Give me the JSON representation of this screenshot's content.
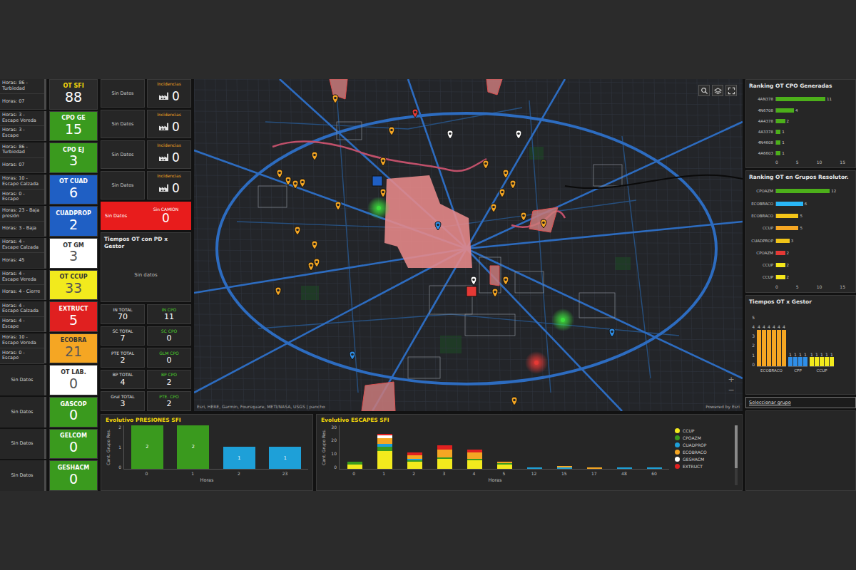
{
  "leftStatus": [
    {
      "lines": [
        "Horas: 86 - Turbiedad",
        "Horas: 07"
      ]
    },
    {
      "lines": [
        "Horas: 3 - Escape Vereda",
        "Horas: 3 - Escape"
      ]
    },
    {
      "lines": [
        "Horas: 86 - Turbiedad",
        "Horas: 07"
      ]
    },
    {
      "lines": [
        "Horas: 10 - Escape Calzada",
        "Horas: 0 - Escape"
      ]
    },
    {
      "lines": [
        "Horas: 23 - Baja presión",
        "Horas: 3 - Baja"
      ]
    },
    {
      "lines": [
        "Horas: 4 - Escape Calzada",
        "Horas: 45"
      ]
    },
    {
      "lines": [
        "Horas: 4 - Escape Vereda",
        "Horas: 4 - Cierre"
      ]
    },
    {
      "lines": [
        "Horas: 4 - Escape Calzada",
        "Horas: 4 - Escape"
      ]
    },
    {
      "lines": [
        "Horas: 10 - Escape Vereda",
        "Horas: 0 - Escape"
      ]
    },
    {
      "lines": [
        "Sin Datos"
      ]
    },
    {
      "lines": [
        "Sin Datos"
      ]
    },
    {
      "lines": [
        "Sin Datos"
      ]
    },
    {
      "lines": [
        "Sin Datos"
      ]
    }
  ],
  "indicators": [
    {
      "title": "OT SFI",
      "value": "88",
      "color": "#2b2b2b"
    },
    {
      "title": "CPO GE",
      "value": "15",
      "color": "#3a9a1e"
    },
    {
      "title": "CPO EJ",
      "value": "3",
      "color": "#3a9a1e"
    },
    {
      "title": "OT CUAD",
      "value": "6",
      "color": "#1f5fc4"
    },
    {
      "title": "CUADPROP",
      "value": "2",
      "color": "#1f5fc4"
    },
    {
      "title": "OT GM",
      "value": "3",
      "color": "#ffffff"
    },
    {
      "title": "OT CCUP",
      "value": "33",
      "color": "#f2ea1d"
    },
    {
      "title": "EXTRUCT",
      "value": "5",
      "color": "#e02020"
    },
    {
      "title": "ECOBRA",
      "value": "21",
      "color": "#f5a623"
    },
    {
      "title": "OT LAB.",
      "value": "0",
      "color": "#ffffff"
    },
    {
      "title": "GASCOP",
      "value": "0",
      "color": "#3a9a1e"
    },
    {
      "title": "GELCOM",
      "value": "0",
      "color": "#3a9a1e"
    },
    {
      "title": "GESHACM",
      "value": "0",
      "color": "#3a9a1e"
    }
  ],
  "incidents": [
    {
      "status": "Sin Datos",
      "label": "Incidencias",
      "value": "0"
    },
    {
      "status": "Sin Datos",
      "label": "Incidencias",
      "value": "0"
    },
    {
      "status": "Sin Datos",
      "label": "Incidencias",
      "value": "0"
    },
    {
      "status": "Sin Datos",
      "label": "Incidencias",
      "value": "0"
    }
  ],
  "alert": {
    "status": "Sin Datos",
    "label": "Sin CAMION",
    "value": "0"
  },
  "timesPanel": {
    "title": "Tiempos OT con PD x Gestor",
    "empty": "Sin datos"
  },
  "stats": [
    {
      "label": "IN TOTAL",
      "value": "70",
      "kind": "total"
    },
    {
      "label": "IN CPO",
      "value": "11",
      "kind": "cpo"
    },
    {
      "label": "SC TOTAL",
      "value": "7",
      "kind": "total"
    },
    {
      "label": "SC CPO",
      "value": "0",
      "kind": "cpo"
    },
    {
      "label": "PTE TOTAL",
      "value": "2",
      "kind": "total"
    },
    {
      "label": "GLM CPO",
      "value": "0",
      "kind": "cpo"
    },
    {
      "label": "BP TOTAL",
      "value": "4",
      "kind": "total"
    },
    {
      "label": "BP CPO",
      "value": "2",
      "kind": "cpo"
    },
    {
      "label": "Gral TOTAL",
      "value": "3",
      "kind": "total"
    },
    {
      "label": "PTE. CPO",
      "value": "2",
      "kind": "cpo"
    }
  ],
  "map": {
    "attribution": "Esri, HERE, Garmin, Foursquare, METI/NASA, USGS | pancho",
    "powered": "Powered by Esri",
    "zoomIn": "+",
    "zoomOut": "−",
    "markers": [
      {
        "kind": "pin",
        "color": "#f5a623"
      },
      {
        "kind": "pin",
        "color": "#e53935"
      },
      {
        "kind": "pin",
        "color": "#f5a623"
      },
      {
        "kind": "pin",
        "color": "#ffffff"
      },
      {
        "kind": "pin",
        "color": "#ffffff"
      },
      {
        "kind": "pin",
        "color": "#f5a623"
      },
      {
        "kind": "pin",
        "color": "#f5a623"
      },
      {
        "kind": "pin",
        "color": "#f5a623"
      },
      {
        "kind": "pin",
        "color": "#f5a623"
      },
      {
        "kind": "pin",
        "color": "#f5a623"
      },
      {
        "kind": "pin",
        "color": "#f5a623"
      },
      {
        "kind": "pin",
        "color": "#f5a623"
      },
      {
        "kind": "pin",
        "color": "#f5a623"
      },
      {
        "kind": "pin",
        "color": "#f5a623"
      },
      {
        "kind": "pin",
        "color": "#f5a623"
      },
      {
        "kind": "pin",
        "color": "#f5a623"
      },
      {
        "kind": "pin",
        "color": "#f5a623"
      },
      {
        "kind": "pin",
        "color": "#f5a623"
      },
      {
        "kind": "pin",
        "color": "#f5a623"
      },
      {
        "kind": "pin",
        "color": "#f5a623"
      },
      {
        "kind": "pin",
        "color": "#f5a623"
      },
      {
        "kind": "pin",
        "color": "#f5a623"
      },
      {
        "kind": "pin",
        "color": "#f5a623"
      },
      {
        "kind": "pin",
        "color": "#f5a623"
      },
      {
        "kind": "pin",
        "color": "#2f8fe8"
      },
      {
        "kind": "pin",
        "color": "#ffffff"
      },
      {
        "kind": "pin",
        "color": "#f5a623"
      },
      {
        "kind": "pin",
        "color": "#f5a623"
      },
      {
        "kind": "square",
        "color": "#e53935"
      },
      {
        "kind": "pin",
        "color": "#f5a623"
      },
      {
        "kind": "pin",
        "color": "#2f8fe8"
      },
      {
        "kind": "pin",
        "color": "#2f8fe8"
      },
      {
        "kind": "pin",
        "color": "#f5a623"
      },
      {
        "kind": "square",
        "color": "#1f5fc4"
      },
      {
        "kind": "glow",
        "color": "#3ddc3d"
      },
      {
        "kind": "glow",
        "color": "#3ddc3d"
      },
      {
        "kind": "glow",
        "color": "#e53935"
      }
    ]
  },
  "presiones": {
    "title": "Evolutivo PRESIONES SFI",
    "yTitle": "Cant. Grupo Res.",
    "xTitle": "Horas",
    "ticks": [
      "0",
      "1",
      "2"
    ],
    "bars": [
      {
        "label": "0",
        "value": 2,
        "text": "2",
        "color": "#3a9a1e"
      },
      {
        "label": "1",
        "value": 2,
        "text": "2",
        "color": "#3a9a1e"
      },
      {
        "label": "2",
        "value": 1,
        "text": "1",
        "color": "#1ea0d8"
      },
      {
        "label": "23",
        "value": 1,
        "text": "1",
        "color": "#1ea0d8"
      }
    ]
  },
  "escapes": {
    "title": "Evolutivo ESCAPES SFI",
    "yTitle": "Cant. Grupo Res.",
    "xTitle": "Horas",
    "ticks": [
      "0",
      "10",
      "20",
      "30"
    ],
    "hours": [
      "0",
      "1",
      "2",
      "3",
      "4",
      "5",
      "12",
      "15",
      "17",
      "48",
      "60"
    ],
    "series": [
      {
        "name": "CCUP",
        "color": "#f2ea1d",
        "values": [
          3,
          12,
          5,
          7,
          6,
          3,
          0,
          0,
          0,
          0,
          0
        ]
      },
      {
        "name": "CPOAZM",
        "color": "#3a9a1e",
        "values": [
          2,
          3,
          1,
          1,
          1,
          1,
          0,
          0,
          0,
          0,
          0
        ]
      },
      {
        "name": "CUADPROP",
        "color": "#1ea0d8",
        "values": [
          0,
          2,
          1,
          0,
          0,
          0,
          1,
          1,
          0,
          1,
          1
        ]
      },
      {
        "name": "ECOBRACO",
        "color": "#f5a623",
        "values": [
          0,
          4,
          2,
          5,
          4,
          1,
          0,
          1,
          1,
          0,
          0
        ]
      },
      {
        "name": "GESHACM",
        "color": "#ffffff",
        "values": [
          0,
          2,
          0,
          0,
          0,
          0,
          0,
          0,
          0,
          0,
          0
        ]
      },
      {
        "name": "EXTRUCT",
        "color": "#e02020",
        "values": [
          0,
          1,
          2,
          3,
          2,
          0,
          0,
          0,
          0,
          0,
          0
        ]
      }
    ]
  },
  "rankingCpo": {
    "title": "Ranking OT CPO Generadas",
    "ticks": [
      "0",
      "5",
      "10",
      "15"
    ],
    "bars": [
      {
        "label": "4AN378",
        "value": 11,
        "text": "11",
        "color": "#4caf1a"
      },
      {
        "label": "4N6708",
        "value": 4,
        "text": "4",
        "color": "#4caf1a"
      },
      {
        "label": "4A4378",
        "value": 2,
        "text": "2",
        "color": "#4caf1a"
      },
      {
        "label": "4A3378",
        "value": 1,
        "text": "1",
        "color": "#4caf1a"
      },
      {
        "label": "4N4608",
        "value": 1,
        "text": "1",
        "color": "#4caf1a"
      },
      {
        "label": "4A6603",
        "value": 1,
        "text": "1",
        "color": "#4caf1a"
      }
    ]
  },
  "rankingGrupos": {
    "title": "Ranking OT en Grupos Resolutor.",
    "ticks": [
      "0",
      "5",
      "10",
      "15"
    ],
    "bars": [
      {
        "label": "CPOAZM",
        "value": 12,
        "text": "12",
        "color": "#4caf1a"
      },
      {
        "label": "ECOBRACO",
        "value": 6,
        "text": "6",
        "color": "#29b6f6"
      },
      {
        "label": "ECOBRACO",
        "value": 5,
        "text": "5",
        "color": "#f5c518"
      },
      {
        "label": "CCUP",
        "value": 5,
        "text": "5",
        "color": "#f5a623"
      },
      {
        "label": "CUADPROP",
        "value": 3,
        "text": "3",
        "color": "#f0c419"
      },
      {
        "label": "CPOAZM",
        "value": 2,
        "text": "2",
        "color": "#e53935"
      },
      {
        "label": "CCUP",
        "value": 2,
        "text": "2",
        "color": "#f5e61b"
      },
      {
        "label": "CCUP",
        "value": 2,
        "text": "2",
        "color": "#f5e61b"
      }
    ]
  },
  "tiemposGestor": {
    "title": "Tiempos OT x Gestor",
    "ticks": [
      "0",
      "1",
      "2",
      "3",
      "4",
      "5"
    ],
    "groups": [
      {
        "label": "ECOBRACO",
        "color": "#f5a623",
        "bars": [
          {
            "value": 4,
            "text": "4"
          },
          {
            "value": 4,
            "text": "4"
          },
          {
            "value": 4,
            "text": "4"
          },
          {
            "value": 4,
            "text": "4"
          },
          {
            "value": 4,
            "text": "4"
          },
          {
            "value": 4,
            "text": "4"
          }
        ]
      },
      {
        "label": "CPP",
        "color": "#2f8fe8",
        "bars": [
          {
            "value": 1,
            "text": "1"
          },
          {
            "value": 1,
            "text": "1"
          },
          {
            "value": 1,
            "text": "1"
          },
          {
            "value": 1,
            "text": "1"
          }
        ]
      },
      {
        "label": "CCUP",
        "color": "#f2ea1d",
        "bars": [
          {
            "value": 1,
            "text": "1"
          },
          {
            "value": 1,
            "text": "1"
          },
          {
            "value": 1,
            "text": "1"
          },
          {
            "value": 1,
            "text": "1"
          },
          {
            "value": 1,
            "text": "1"
          }
        ]
      }
    ]
  },
  "filter": {
    "value": "Seleccionar grupo"
  }
}
